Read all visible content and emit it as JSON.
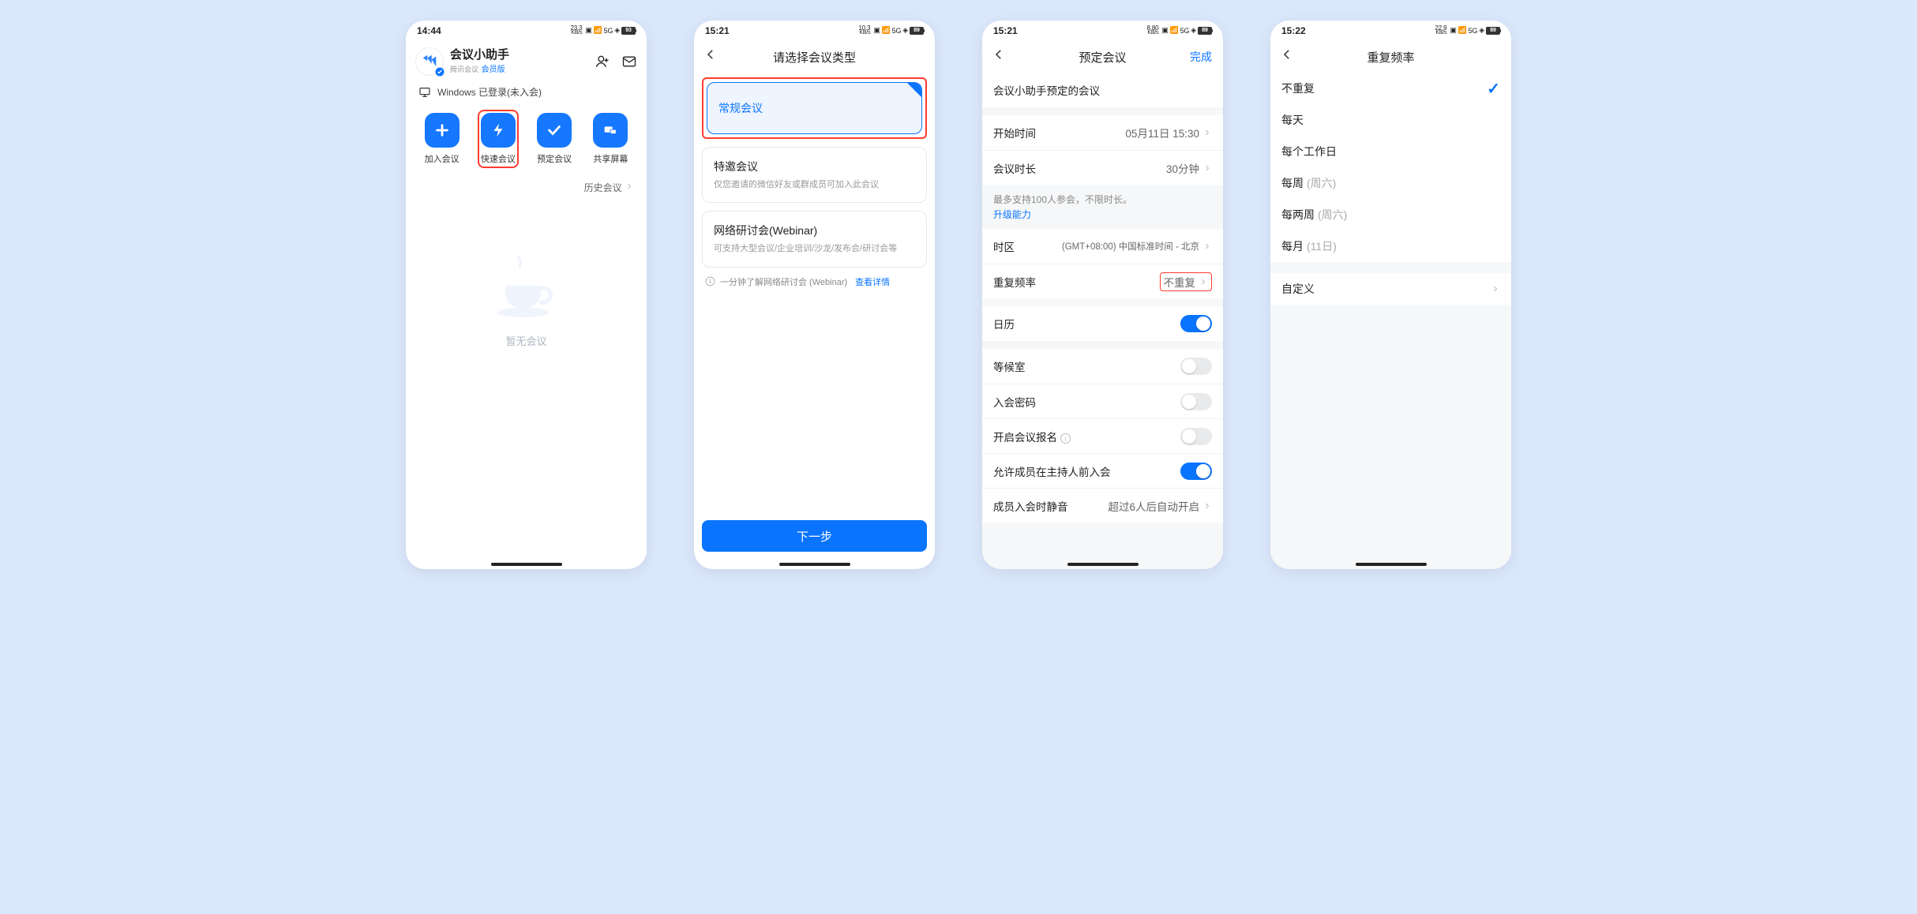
{
  "screen1": {
    "time": "14:44",
    "netspeed": "23.3",
    "netunit": "KB/s",
    "battery": "93",
    "title": "会议小助手",
    "brand": "腾讯会议",
    "member": "会员版",
    "login_status": "Windows 已登录(未入会)",
    "actions": [
      "加入会议",
      "快速会议",
      "预定会议",
      "共享屏幕"
    ],
    "history": "历史会议",
    "empty": "暂无会议"
  },
  "screen2": {
    "time": "15:21",
    "netspeed": "10.3",
    "netunit": "KB/s",
    "battery": "89",
    "title": "请选择会议类型",
    "opt1": "常规会议",
    "opt2_t": "特邀会议",
    "opt2_d": "仅您邀请的微信好友或群成员可加入此会议",
    "opt3_t": "网络研讨会(Webinar)",
    "opt3_d": "可支持大型会议/企业培训/沙龙/发布会/研讨会等",
    "learn": "一分钟了解网络研讨会 (Webinar)",
    "learn_link": "查看详情",
    "next": "下一步"
  },
  "screen3": {
    "time": "15:21",
    "netspeed": "8.80",
    "netunit": "KB/s",
    "battery": "89",
    "title": "预定会议",
    "done": "完成",
    "meeting_name": "会议小助手预定的会议",
    "rows": {
      "start_l": "开始时间",
      "start_v": "05月11日 15:30",
      "dur_l": "会议时长",
      "dur_v": "30分钟",
      "note1": "最多支持100人参会，不限时长。",
      "note_link": "升级能力",
      "tz_l": "时区",
      "tz_v": "(GMT+08:00) 中国标准时间 - 北京",
      "repeat_l": "重复频率",
      "repeat_v": "不重复",
      "cal_l": "日历",
      "wait_l": "等候室",
      "pwd_l": "入会密码",
      "signup_l": "开启会议报名",
      "before_l": "允许成员在主持人前入会",
      "mute_l": "成员入会时静音",
      "mute_v": "超过6人后自动开启"
    }
  },
  "screen4": {
    "time": "15:22",
    "netspeed": "22.9",
    "netunit": "KB/s",
    "battery": "89",
    "title": "重复频率",
    "opts": [
      {
        "l": "不重复",
        "h": "",
        "sel": true
      },
      {
        "l": "每天",
        "h": ""
      },
      {
        "l": "每个工作日",
        "h": ""
      },
      {
        "l": "每周",
        "h": "(周六)"
      },
      {
        "l": "每两周",
        "h": "(周六)"
      },
      {
        "l": "每月",
        "h": "(11日)"
      }
    ],
    "custom": "自定义"
  }
}
